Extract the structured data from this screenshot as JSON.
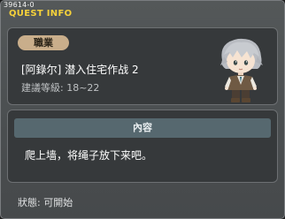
{
  "window": {
    "quest_id": "39614-0",
    "title": "QUEST INFO"
  },
  "quest": {
    "job_tag": "職業",
    "name": "[阿錄尔] 潜入住宅作战 2",
    "level": "建議等級: 18~22"
  },
  "npc": {
    "icon": "silver-haired-npc-portrait"
  },
  "content": {
    "header": "內容",
    "text": "爬上墙，将绳子放下来吧。"
  },
  "status": {
    "text": "狀態: 可開始"
  },
  "colors": {
    "title": "#f5d13a",
    "tag_bg": "#c9ae8b",
    "header_bg": "#56686f"
  }
}
